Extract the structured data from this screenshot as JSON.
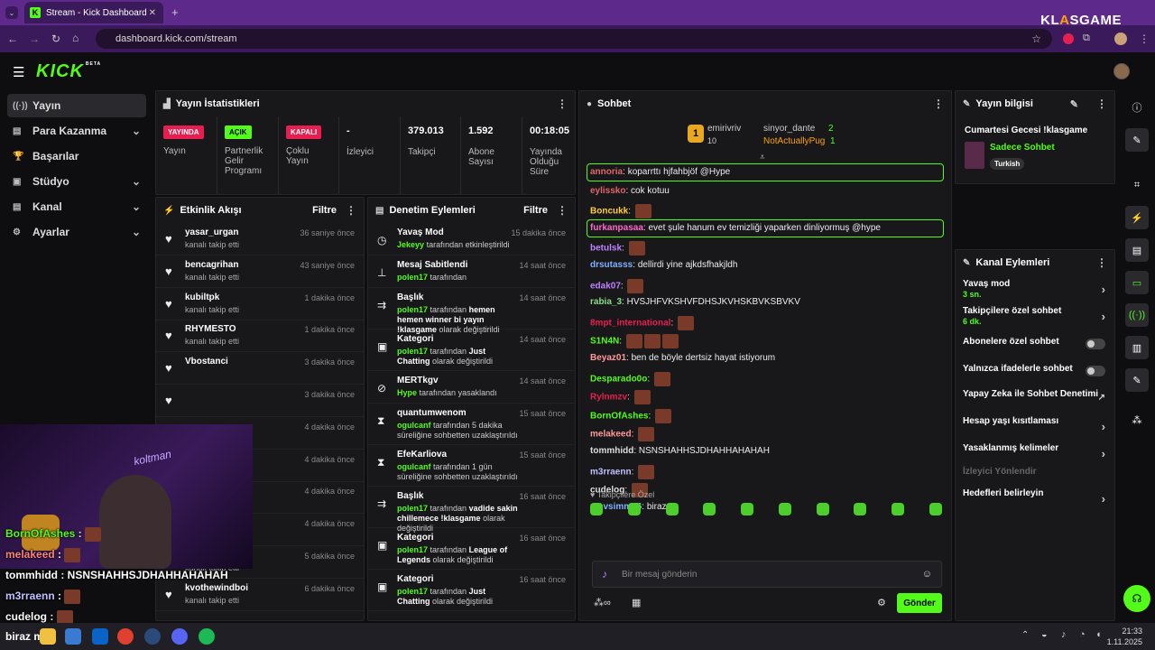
{
  "browser": {
    "tab_title": "Stream - Kick Dashboard",
    "url": "dashboard.kick.com/stream",
    "brand_a": "KL",
    "brand_b": "A",
    "brand_c": "SGAME"
  },
  "app": {
    "logo": "KICK",
    "beta": "BETA"
  },
  "sidebar": {
    "items": [
      {
        "label": "Yayın",
        "icon": "broadcast-icon"
      },
      {
        "label": "Para Kazanma",
        "icon": "money-icon"
      },
      {
        "label": "Başarılar",
        "icon": "trophy-icon"
      },
      {
        "label": "Stüdyo",
        "icon": "studio-icon"
      },
      {
        "label": "Kanal",
        "icon": "channel-icon"
      },
      {
        "label": "Ayarlar",
        "icon": "settings-icon"
      }
    ]
  },
  "stats": {
    "title": "Yayın İstatistikleri",
    "items": [
      {
        "badge": "YAYINDA",
        "badge_color": "#e81e50",
        "label": "Yayın"
      },
      {
        "badge": "AÇIK",
        "badge_color": "#53fc18",
        "label": "Partnerlik Gelir Programı"
      },
      {
        "badge": "KAPALI",
        "badge_color": "#e81e50",
        "label": "Çoklu Yayın"
      },
      {
        "value": "-",
        "label": "İzleyici"
      },
      {
        "value": "379.013",
        "label": "Takipçi"
      },
      {
        "value": "1.592",
        "label": "Abone Sayısı"
      },
      {
        "value": "00:18:05",
        "label": "Yayında Olduğu Süre"
      }
    ]
  },
  "activity": {
    "title": "Etkinlik Akışı",
    "filter": "Filtre",
    "rows": [
      {
        "name": "yasar_urgan",
        "sub": "kanalı takip etti",
        "time": "36 saniye önce"
      },
      {
        "name": "bencagrihan",
        "sub": "kanalı takip etti",
        "time": "43 saniye önce"
      },
      {
        "name": "kubiltpk",
        "sub": "kanalı takip etti",
        "time": "1 dakika önce"
      },
      {
        "name": "RHYMESTO",
        "sub": "kanalı takip etti",
        "time": "1 dakika önce"
      },
      {
        "name": "Vbostanci",
        "sub": "",
        "time": "3 dakika önce"
      },
      {
        "name": "",
        "sub": "",
        "time": "3 dakika önce"
      },
      {
        "name": "",
        "sub": "",
        "time": "4 dakika önce"
      },
      {
        "name": "",
        "sub": "",
        "time": "4 dakika önce"
      },
      {
        "name": "",
        "sub": "",
        "time": "4 dakika önce"
      },
      {
        "name": "secgin123",
        "sub": "kanalı takip etti",
        "time": "4 dakika önce"
      },
      {
        "name": "Arsahvin",
        "sub": "kanalı takip etti",
        "time": "5 dakika önce"
      },
      {
        "name": "kvothewindboi",
        "sub": "kanalı takip etti",
        "time": "6 dakika önce"
      }
    ]
  },
  "moderation": {
    "title": "Denetim Eylemleri",
    "filter": "Filtre",
    "rows": [
      {
        "name": "Yavaş Mod",
        "user": "Jekeyy",
        "text": "tarafından etkinleştirildi",
        "time": "15 dakika önce"
      },
      {
        "name": "Mesaj Sabitlendi",
        "user": "polen17",
        "text": "tarafından",
        "time": "14 saat önce"
      },
      {
        "name": "Başlık",
        "user": "polen17",
        "text": "tarafından",
        "val": "hemen hemen winner bi yayın !klasgame",
        "tail": "olarak değiştirildi",
        "time": "14 saat önce"
      },
      {
        "name": "Kategori",
        "user": "polen17",
        "text": "tarafından",
        "val": "Just Chatting",
        "tail": "olarak değiştirildi",
        "time": "14 saat önce"
      },
      {
        "name": "MERTkgv",
        "user": "Hype",
        "text": "tarafından yasaklandı",
        "time": "14 saat önce"
      },
      {
        "name": "quantumwenom",
        "user": "ogulcanf",
        "text": "tarafından 5 dakika süreliğine sohbetten uzaklaştırıldı",
        "time": "15 saat önce"
      },
      {
        "name": "EfeKarliova",
        "user": "ogulcanf",
        "text": "tarafından 1 gün süreliğine sohbetten uzaklaştırıldı",
        "time": "15 saat önce"
      },
      {
        "name": "Başlık",
        "user": "polen17",
        "text": "tarafından",
        "val": "vadide sakin chillemece !klasgame",
        "tail": "olarak değiştirildi",
        "time": "16 saat önce"
      },
      {
        "name": "Kategori",
        "user": "polen17",
        "text": "tarafından",
        "val": "League of Legends",
        "tail": "olarak değiştirildi",
        "time": "16 saat önce"
      },
      {
        "name": "Kategori",
        "user": "polen17",
        "text": "tarafından",
        "val": "Just Chatting",
        "tail": "olarak değiştirildi",
        "time": "16 saat önce"
      }
    ]
  },
  "chat": {
    "title": "Sohbet",
    "top": [
      {
        "rank": "1",
        "name": "emirivriv",
        "count": "10"
      },
      {
        "name": "sinyor_dante",
        "count": "2"
      },
      {
        "name": "NotActuallyPug",
        "count": "1"
      }
    ],
    "messages": [
      {
        "user": "annoria",
        "color": "#e06666",
        "text": "koparrttı hjfahbjöf @Hype",
        "hl": true
      },
      {
        "user": "eylissko",
        "color": "#e06666",
        "text": "cok kotuu"
      },
      {
        "user": "Boncukk",
        "color": "#ffcc33",
        "text": "",
        "emo": 1
      },
      {
        "user": "furkanpasaa",
        "color": "#ff66cc",
        "text": "evet şule hanum ev temizliği yaparken dinliyormuş @hype",
        "hl": true
      },
      {
        "user": "betulsk",
        "color": "#c080ff",
        "text": "",
        "emo": 1
      },
      {
        "user": "drsutasss",
        "color": "#80b0ff",
        "text": "dellirdi yine ajkdsfhakjldh"
      },
      {
        "user": "edak07",
        "color": "#c080ff",
        "text": "",
        "emo": 1
      },
      {
        "user": "rabia_3",
        "color": "#88dd88",
        "text": "HVSJHFVKSHVFDHSJKVHSKBVKSBVKV"
      },
      {
        "user": "8mpt_international",
        "color": "#e81e50",
        "text": "",
        "emo": 1
      },
      {
        "user": "S1N4N",
        "color": "#53fc18",
        "text": "",
        "emo": 3
      },
      {
        "user": "Beyaz01",
        "color": "#ff9999",
        "text": "ben de böyle dertsiz hayat istiyorum"
      },
      {
        "user": "Desparado0o",
        "color": "#53fc18",
        "text": "",
        "emo": 1
      },
      {
        "user": "Rylnmzv",
        "color": "#e81e50",
        "text": "",
        "emo": 1
      },
      {
        "user": "BornOfAshes",
        "color": "#53fc18",
        "text": "",
        "emo": 1
      },
      {
        "user": "melakeed",
        "color": "#ff9999",
        "text": "",
        "emo": 1
      },
      {
        "user": "tommhidd",
        "color": "#dddddd",
        "text": "NSNSHAHHSJDHAHHAHAHAH"
      },
      {
        "user": "m3rraenn",
        "color": "#c0c0ff",
        "text": "",
        "emo": 1
      },
      {
        "user": "cudelog",
        "color": "#dddddd",
        "text": "",
        "emo": 1
      },
      {
        "user": "mevsimm46",
        "color": "#80b0ff",
        "text": "biraz mı"
      }
    ],
    "followers_only": "Takipçilere Özel",
    "input_placeholder": "Bir mesaj gönderin",
    "send": "Gönder"
  },
  "info": {
    "title": "Yayın bilgisi",
    "stream_title": "Cumartesi Gecesi !klasgame",
    "category": "Sadece Sohbet",
    "tag": "Turkish"
  },
  "channel": {
    "title": "Kanal Eylemleri",
    "items": [
      {
        "label": "Yavaş mod",
        "sub": "3 sn.",
        "type": "chevron"
      },
      {
        "label": "Takipçilere özel sohbet",
        "sub": "6 dk.",
        "type": "chevron"
      },
      {
        "label": "Abonelere özel sohbet",
        "type": "toggle"
      },
      {
        "label": "Yalnızca ifadelerle sohbet",
        "type": "toggle"
      },
      {
        "label": "Yapay Zeka ile Sohbet Denetimi",
        "type": "external"
      },
      {
        "label": "Hesap yaşı kısıtlaması",
        "type": "chevron"
      },
      {
        "label": "Yasaklanmış kelimeler",
        "type": "chevron"
      },
      {
        "label": "İzleyici Yönlendir",
        "type": "disabled"
      },
      {
        "label": "Hedefleri belirleyin",
        "type": "chevron"
      }
    ]
  },
  "overlay": {
    "neon": "koltman",
    "lines": [
      {
        "user": "BornOfAshes",
        "color": "#53fc18",
        "text": ""
      },
      {
        "user": "melakeed",
        "color": "#ff8080",
        "text": ""
      },
      {
        "user": "tommhidd",
        "color": "#ffffff",
        "text": "NSNSHAHHSJDHAHHAHAHAH"
      },
      {
        "user": "m3rraenn",
        "color": "#c0c0ff",
        "text": ""
      },
      {
        "user": "cudelog",
        "color": "#ffffff",
        "text": ""
      }
    ],
    "bottom": "biraz mı"
  },
  "taskbar": {
    "time": "21:33",
    "date": "1.11.2025"
  }
}
